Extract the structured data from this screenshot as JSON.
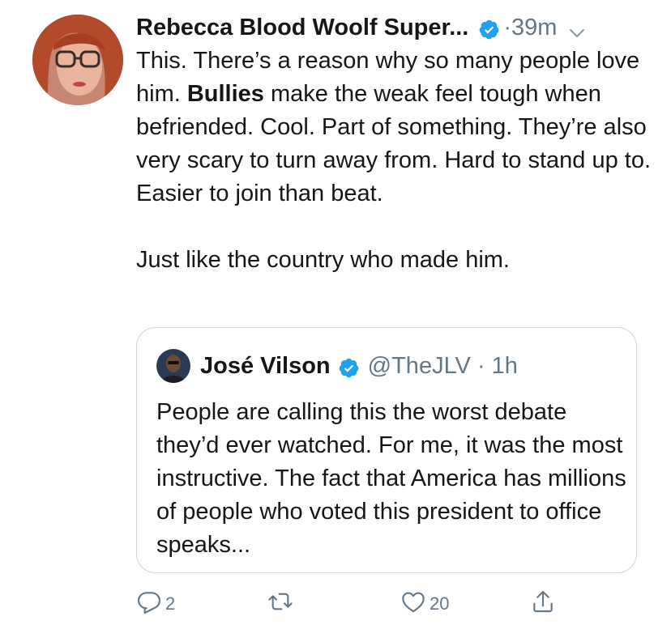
{
  "tweet": {
    "author_name": "Rebecca Blood Woolf Super...",
    "time_meta": "·39m",
    "text_line1_pre": "This. There’s a reason why so many people love him. ",
    "text_bold": "Bullies",
    "text_line1_post": " make the weak feel tough when befriended. Cool. Part of something. They’re also very scary to turn away from. Hard to stand up to. Easier to join than beat.",
    "text_para2": "Just like the country who made him."
  },
  "quote": {
    "author_name": "José Vilson",
    "handle_meta": "@TheJLV · 1h",
    "text": "People are calling this the worst debate they’d ever watched. For me, it was the most instructive. The fact that America has millions of people who voted this president to office speaks..."
  },
  "actions": {
    "reply_count": "2",
    "retweet_count": "",
    "like_count": "20"
  },
  "icons": {
    "verified": "verified-badge-icon",
    "caret": "chevron-down-icon",
    "reply": "reply-icon",
    "retweet": "retweet-icon",
    "like": "heart-icon",
    "share": "share-icon"
  },
  "colors": {
    "verified_blue": "#1da1f2",
    "meta_gray": "#657786",
    "border": "#ccd6dd",
    "text": "#14171a"
  }
}
